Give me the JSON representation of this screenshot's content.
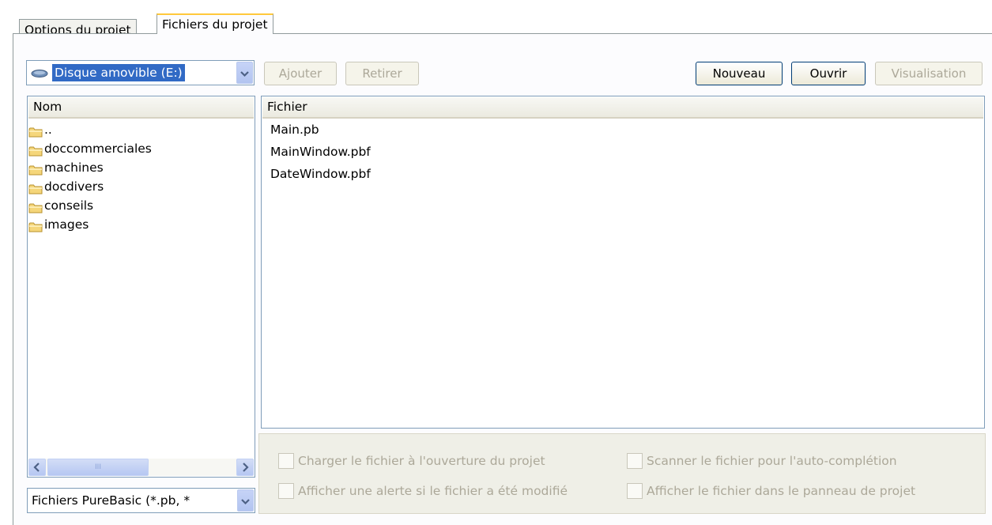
{
  "tabs": [
    {
      "label": "Options du projet",
      "active": false
    },
    {
      "label": "Fichiers du projet",
      "active": true
    }
  ],
  "drive_select": {
    "value": "Disque amovible (E:)"
  },
  "toolbar": {
    "add_label": "Ajouter",
    "remove_label": "Retirer",
    "new_label": "Nouveau",
    "open_label": "Ouvrir",
    "view_label": "Visualisation"
  },
  "folder_list": {
    "header": "Nom",
    "items": [
      "..",
      "doccommerciales",
      "machines",
      "docdivers",
      "conseils",
      "images"
    ]
  },
  "file_list": {
    "header": "Fichier",
    "items": [
      "Main.pb",
      "MainWindow.pbf",
      "DateWindow.pbf"
    ]
  },
  "scrollbar": {
    "thumb_grip": "III"
  },
  "filter_select": {
    "value": "Fichiers PureBasic (*.pb, *"
  },
  "options": {
    "load_on_open": "Charger le fichier à l'ouverture du projet",
    "scan_autocomplete": "Scanner le fichier pour l'auto-complétion",
    "warn_modified": "Afficher une alerte si le fichier a été modifié",
    "show_in_panel": "Afficher le fichier dans le panneau de projet"
  },
  "colors": {
    "selection": "#316ac5",
    "tab_highlight": "#ffc83c",
    "border": "#7f9db9"
  },
  "icons": {
    "drive": "removable-drive-icon",
    "folder": "folder-icon"
  }
}
